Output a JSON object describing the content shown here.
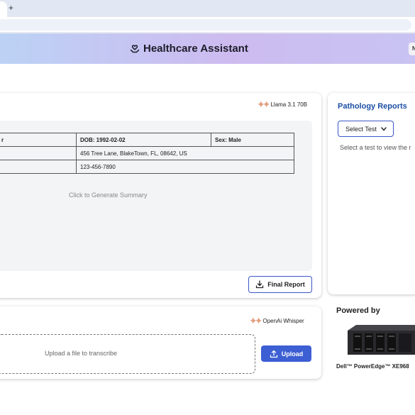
{
  "browser": {
    "new_tab_label": "+"
  },
  "header": {
    "title": "Healthcare Assistant",
    "button_label": "N"
  },
  "main_card": {
    "model_label": "Llama 3.1 70B",
    "patient_table": {
      "rows": [
        [
          "r",
          "DOB: 1992-02-02",
          "Sex: Male"
        ],
        [
          "",
          "456 Tree Lane, BlakeTown, FL, 08642, US"
        ],
        [
          "",
          "123-456-7890"
        ]
      ]
    },
    "summary_placeholder": "Click to Generate Summary",
    "final_report_label": "Final Report"
  },
  "transcribe_card": {
    "model_label": "OpenAi Whisper",
    "upload_hint": "Upload a file to transcribe",
    "upload_label": "Upload"
  },
  "pathology": {
    "title": "Pathology Reports",
    "select_value": "Select Test",
    "hint": "Select a test to view the r"
  },
  "powered_by": {
    "heading": "Powered by",
    "product": "Dell™ PowerEdge™ XE968"
  }
}
